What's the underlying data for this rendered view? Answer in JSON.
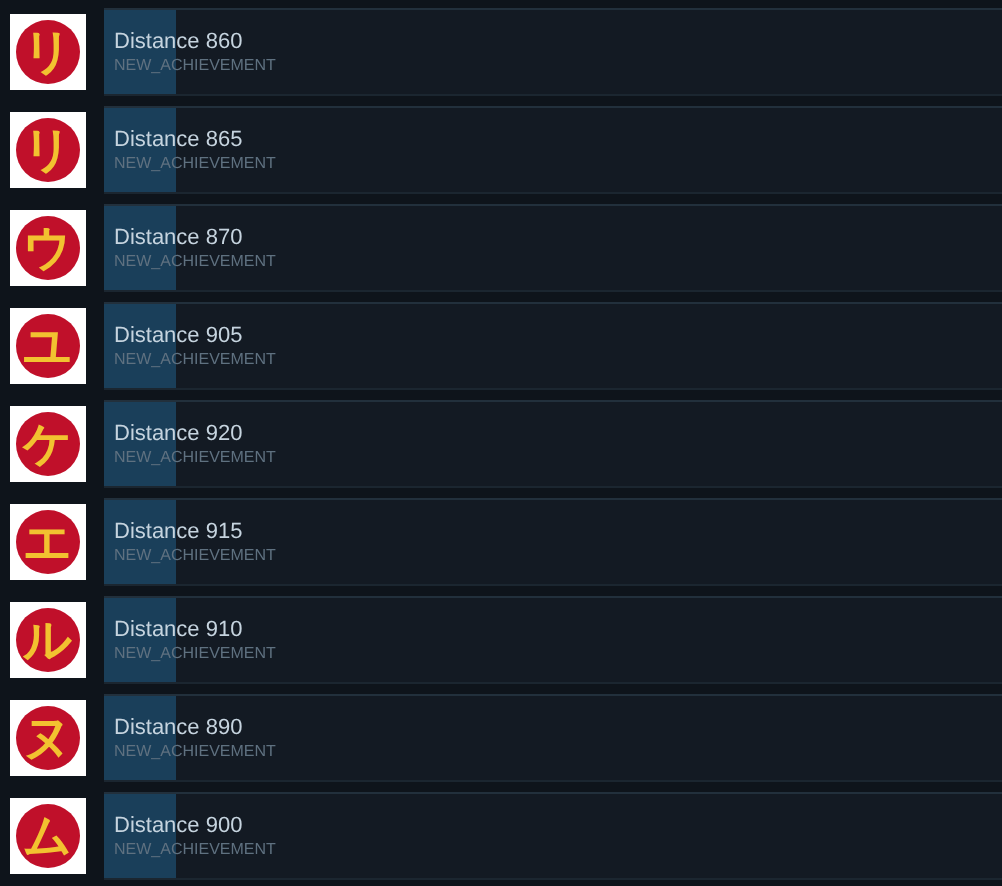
{
  "achievements": [
    {
      "glyph": "リ",
      "title": "Distance 860",
      "subtitle": "NEW_ACHIEVEMENT",
      "level": 0.08
    },
    {
      "glyph": "リ",
      "title": "Distance 865",
      "subtitle": "NEW_ACHIEVEMENT",
      "level": 0.08
    },
    {
      "glyph": "ウ",
      "title": "Distance 870",
      "subtitle": "NEW_ACHIEVEMENT",
      "level": 0.08
    },
    {
      "glyph": "ユ",
      "title": "Distance 905",
      "subtitle": "NEW_ACHIEVEMENT",
      "level": 0.08
    },
    {
      "glyph": "ケ",
      "title": "Distance 920",
      "subtitle": "NEW_ACHIEVEMENT",
      "level": 0.08
    },
    {
      "glyph": "エ",
      "title": "Distance 915",
      "subtitle": "NEW_ACHIEVEMENT",
      "level": 0.08
    },
    {
      "glyph": "ル",
      "title": "Distance 910",
      "subtitle": "NEW_ACHIEVEMENT",
      "level": 0.08
    },
    {
      "glyph": "ヌ",
      "title": "Distance 890",
      "subtitle": "NEW_ACHIEVEMENT",
      "level": 0.08
    },
    {
      "glyph": "ム",
      "title": "Distance 900",
      "subtitle": "NEW_ACHIEVEMENT",
      "level": 0.08
    }
  ]
}
